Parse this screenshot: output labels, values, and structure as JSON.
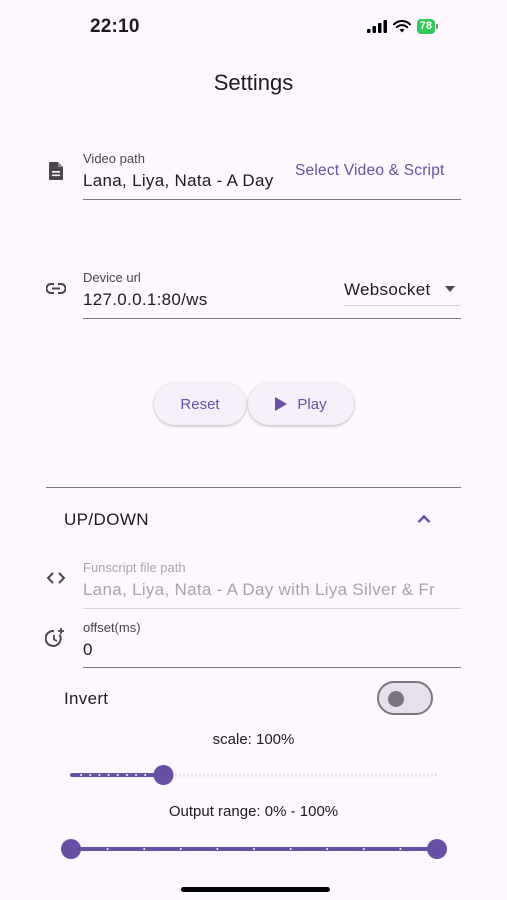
{
  "status_bar": {
    "time": "22:10",
    "battery": "78"
  },
  "page": {
    "title": "Settings"
  },
  "video": {
    "label": "Video path",
    "value": "Lana, Liya, Nata - A Day",
    "select_button": "Select Video & Script",
    "icon": "file-icon"
  },
  "device": {
    "label": "Device url",
    "value": "127.0.0.1:80/ws",
    "protocol": "Websocket",
    "icon": "link-icon"
  },
  "actions": {
    "reset": "Reset",
    "play": "Play"
  },
  "axis_section": {
    "title": "UP/DOWN",
    "expanded": true,
    "funscript": {
      "label": "Funscript file path",
      "value": "Lana, Liya, Nata - A Day with Liya Silver & Fr",
      "icon": "code-icon"
    },
    "offset": {
      "label": "offset(ms)",
      "value": "0",
      "icon": "clock-plus-icon"
    },
    "invert": {
      "label": "Invert",
      "value": false
    },
    "scale": {
      "label": "scale: 100%",
      "value": 100,
      "min": 0,
      "max": 400,
      "divisions": 40
    },
    "output_range": {
      "label": "Output range: 0% - 100%",
      "low": 0,
      "high": 100,
      "divisions": 10
    }
  },
  "colors": {
    "accent": "#6750a4",
    "background": "#fdf7ff",
    "inactive_track": "#cac4d0"
  }
}
